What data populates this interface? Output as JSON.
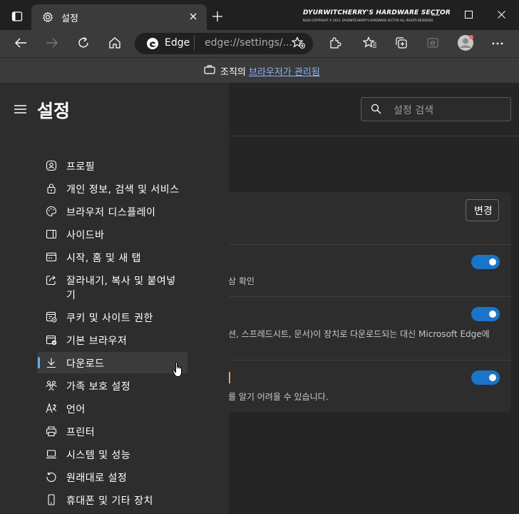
{
  "window": {
    "tab_title": "설정",
    "watermark_title": "DYURWITCHERRY'S HARDWARE SECTOR",
    "watermark_sub": "BLOG COPYRIGHT © 2013. DYURWITCHERRY'S HARDWARE SECTOR ALL RIGHTS RESERVED."
  },
  "address": {
    "site_name": "Edge",
    "url": "edge://settings/..."
  },
  "notice": {
    "prefix": "조직의 ",
    "link": "브라우저가 관리됨"
  },
  "settings": {
    "title": "설정",
    "search_placeholder": "설정 검색",
    "change_button": "변경",
    "row1_desc": "상 확인",
    "row2_desc": "션, 스프레드시트, 문서)이 장치로 다운로드되는 대신 Microsoft Edge에",
    "row3_desc": "를 알기 어려울 수 있습니다.",
    "toggles": [
      true,
      true,
      true
    ]
  },
  "sidebar": {
    "items": [
      {
        "label": "프로필",
        "icon": "profile-icon"
      },
      {
        "label": "개인 정보, 검색 및 서비스",
        "icon": "lock-icon"
      },
      {
        "label": "브라우저 디스플레이",
        "icon": "palette-icon"
      },
      {
        "label": "사이드바",
        "icon": "sidebar-icon"
      },
      {
        "label": "시작, 홈 및 새 탭",
        "icon": "home-tab-icon"
      },
      {
        "label": "잘라내기, 복사 및 붙여넣",
        "label2": "기",
        "icon": "share-icon"
      },
      {
        "label": "쿠키 및 사이트 권한",
        "icon": "cookie-icon"
      },
      {
        "label": "기본 브라우저",
        "icon": "default-browser-icon"
      },
      {
        "label": "다운로드",
        "icon": "download-icon",
        "active": true
      },
      {
        "label": "가족 보호 설정",
        "icon": "family-icon"
      },
      {
        "label": "언어",
        "icon": "language-icon"
      },
      {
        "label": "프린터",
        "icon": "printer-icon"
      },
      {
        "label": "시스템 및 성능",
        "icon": "laptop-icon"
      },
      {
        "label": "원래대로 설정",
        "icon": "reset-icon"
      },
      {
        "label": "휴대폰 및 기타 장치",
        "icon": "phone-icon"
      }
    ]
  },
  "colors": {
    "accent": "#1a74c8",
    "link": "#8ab4f8",
    "active_indicator": "#5eb1ef"
  }
}
